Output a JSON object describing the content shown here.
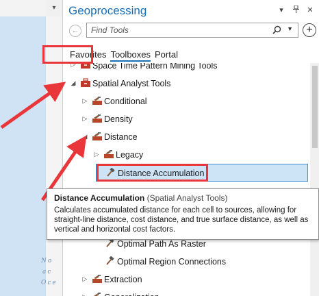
{
  "left_panel": {
    "chevron": "▾",
    "map_text": [
      "No",
      "ac",
      "Oce"
    ]
  },
  "pane": {
    "title": "Geoprocessing",
    "title_buttons": {
      "options": "▾",
      "pin": "📌",
      "close": "✕"
    },
    "back_label": "←",
    "search": {
      "placeholder": "Find Tools",
      "value": ""
    },
    "add_label": "+",
    "tabs": [
      {
        "label": "Favorites",
        "active": false
      },
      {
        "label": "Toolboxes",
        "active": true
      },
      {
        "label": "Portal",
        "active": false
      }
    ]
  },
  "tree": [
    {
      "label": "Space Time Pattern Mining Tools",
      "type": "toolbox",
      "expanded": false,
      "level": 0,
      "partial": true
    },
    {
      "label": "Spatial Analyst Tools",
      "type": "toolbox",
      "expanded": true,
      "level": 0
    },
    {
      "label": "Conditional",
      "type": "toolset",
      "expanded": false,
      "level": 1
    },
    {
      "label": "Density",
      "type": "toolset",
      "expanded": false,
      "level": 1
    },
    {
      "label": "Distance",
      "type": "toolset",
      "expanded": true,
      "level": 1
    },
    {
      "label": "Legacy",
      "type": "toolset",
      "expanded": false,
      "level": 2
    },
    {
      "label": "Distance Accumulation",
      "type": "tool",
      "level": 2,
      "selected": true
    },
    {
      "label": "Optimal Path As Raster",
      "type": "tool",
      "level": 2
    },
    {
      "label": "Optimal Region Connections",
      "type": "tool",
      "level": 2
    },
    {
      "label": "Extraction",
      "type": "toolset",
      "expanded": false,
      "level": 1
    },
    {
      "label": "Generalization",
      "type": "toolset",
      "expanded": false,
      "level": 1
    }
  ],
  "tooltip": {
    "title": "Distance Accumulation",
    "subtitle": "(Spatial Analyst Tools)",
    "description": "Calculates accumulated distance for each cell to sources, allowing for straight-line distance, cost distance, and true surface distance, as well as vertical and horizontal cost factors."
  },
  "colors": {
    "accent": "#1a6fb5",
    "annotation_red": "#e8363a",
    "selection_bg": "#cde4f7",
    "toolbox_red": "#c0392b"
  }
}
